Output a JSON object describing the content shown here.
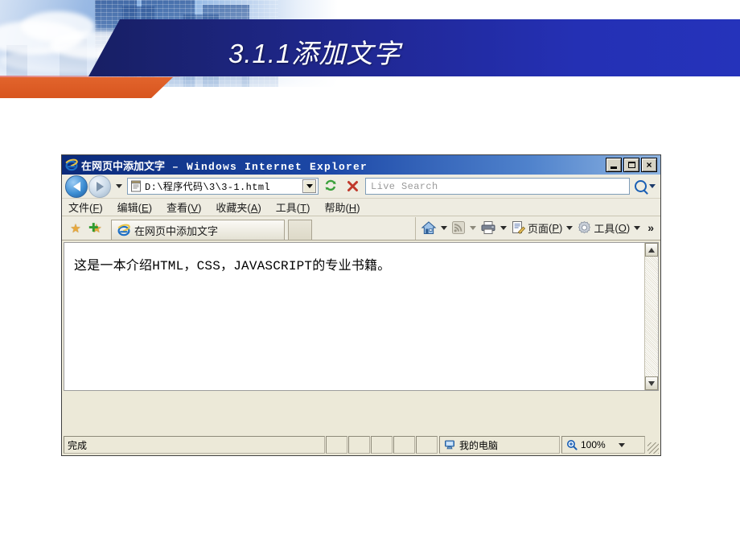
{
  "slide": {
    "title": "3.1.1添加文字"
  },
  "browser": {
    "window_title_cn": "在网页中添加文字",
    "window_title_sep": " – ",
    "window_title_en": "Windows Internet Explorer",
    "window_buttons": {
      "minimize": "minimize",
      "maximize": "maximize",
      "close": "×"
    },
    "nav": {
      "back": "back-arrow",
      "forward": "forward-arrow",
      "history_caret": "chevron-down-icon",
      "address_value": "D:\\程序代码\\3\\3-1.html",
      "address_dropdown": "chevron-down-icon",
      "refresh": "↺",
      "stop": "✕",
      "search_placeholder": "Live Search",
      "search_value": "",
      "search_go": "search-icon",
      "search_caret": "chevron-down-icon"
    },
    "menu": [
      {
        "label": "文件",
        "accel": "F"
      },
      {
        "label": "编辑",
        "accel": "E"
      },
      {
        "label": "查看",
        "accel": "V"
      },
      {
        "label": "收藏夹",
        "accel": "A"
      },
      {
        "label": "工具",
        "accel": "T"
      },
      {
        "label": "帮助",
        "accel": "H"
      }
    ],
    "favorites": {
      "favorites_center": "★",
      "add_favorite": "★"
    },
    "tab": {
      "label": "在网页中添加文字"
    },
    "toolbar": {
      "home": "home-icon",
      "feeds": "rss-icon",
      "print": "printer-icon",
      "page_label": "页面",
      "page_accel": "P",
      "tools_label": "工具",
      "tools_accel": "O",
      "overflow": "»"
    },
    "content": {
      "body_text": "这是一本介绍HTML，CSS，JAVASCRIPT的专业书籍。"
    },
    "status": {
      "message": "完成",
      "zone": "我的电脑",
      "zoom": "100%"
    }
  },
  "colors": {
    "banner_dark": "#141b56",
    "banner_light": "#2533bb",
    "orange": "#db5a22",
    "titlebar_start": "#0b2a7a",
    "chrome": "#eeece1"
  }
}
